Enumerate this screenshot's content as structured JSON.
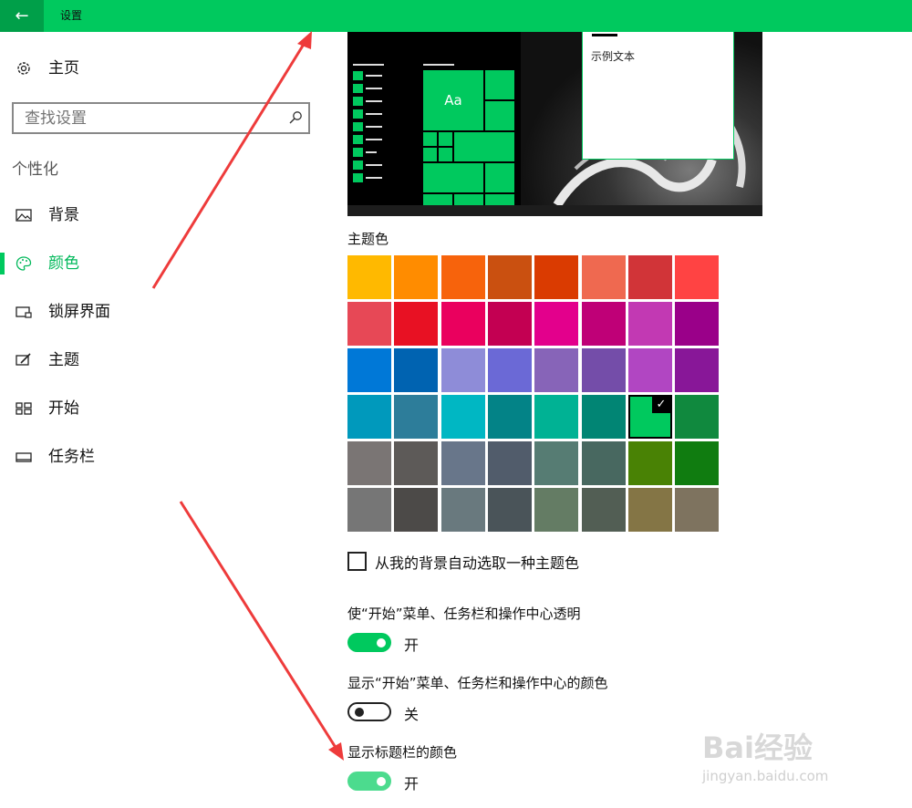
{
  "window": {
    "title": "设置",
    "back_icon": "arrow-left-icon",
    "accent": "#00c95e"
  },
  "sidebar": {
    "home": {
      "label": "主页",
      "icon": "gear-icon"
    },
    "search": {
      "placeholder": "查找设置",
      "icon": "search-icon"
    },
    "group": "个性化",
    "items": [
      {
        "label": "背景",
        "icon": "picture-icon",
        "selected": false
      },
      {
        "label": "颜色",
        "icon": "palette-icon",
        "selected": true
      },
      {
        "label": "锁屏界面",
        "icon": "lock-screen-icon",
        "selected": false
      },
      {
        "label": "主题",
        "icon": "theme-icon",
        "selected": false
      },
      {
        "label": "开始",
        "icon": "start-icon",
        "selected": false
      },
      {
        "label": "任务栏",
        "icon": "taskbar-icon",
        "selected": false
      }
    ]
  },
  "preview": {
    "sample_text": "示例文本",
    "tile_text": "Aa"
  },
  "accent_colors": {
    "label": "主题色",
    "selected_index": 30,
    "swatches": [
      "#ffb900",
      "#ff8c00",
      "#f7630c",
      "#ca5010",
      "#da3b01",
      "#ef6950",
      "#d13438",
      "#ff4343",
      "#e74856",
      "#e81123",
      "#ea005e",
      "#c30052",
      "#e3008c",
      "#bf0077",
      "#c239b3",
      "#9a0089",
      "#0078d7",
      "#0063b1",
      "#8e8cd8",
      "#6b69d6",
      "#8764b8",
      "#744da9",
      "#b146c2",
      "#881798",
      "#0099bc",
      "#2d7d9a",
      "#00b7c3",
      "#038387",
      "#00b294",
      "#018574",
      "#00c95e",
      "#10893e",
      "#7a7574",
      "#5d5a58",
      "#68768a",
      "#515c6b",
      "#567c73",
      "#486860",
      "#498205",
      "#107c10",
      "#767676",
      "#4c4a48",
      "#69797e",
      "#4a5459",
      "#647c64",
      "#525e54",
      "#847545",
      "#7e735f"
    ]
  },
  "auto_pick": {
    "label": "从我的背景自动选取一种主题色",
    "checked": false
  },
  "options": [
    {
      "label": "使“开始”菜单、任务栏和操作中心透明",
      "state": "开",
      "on": true
    },
    {
      "label": "显示“开始”菜单、任务栏和操作中心的颜色",
      "state": "关",
      "on": false
    },
    {
      "label": "显示标题栏的颜色",
      "state": "开",
      "on": true
    }
  ],
  "watermark": {
    "text": "Bai经验",
    "url_text": "jingyan.baidu.com"
  }
}
